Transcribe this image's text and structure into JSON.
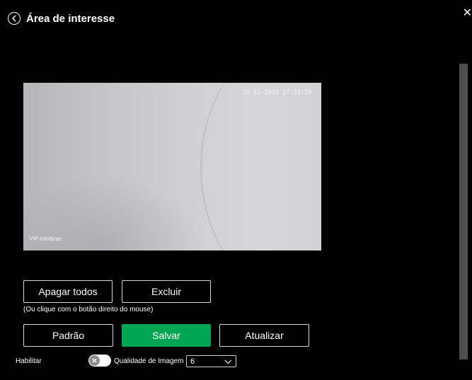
{
  "header": {
    "title": "Área de interesse"
  },
  "video": {
    "timestamp": "26-12-2024 17:33:35",
    "osd_label": "VIP-intelbras"
  },
  "actions": {
    "clear_all": "Apagar todos",
    "delete": "Excluir",
    "hint": "(Ou clique com o botão direito do mouse)",
    "default": "Padrão",
    "save": "Salvar",
    "refresh": "Atualizar"
  },
  "settings": {
    "enable_label": "Habilitar",
    "enable_state": false,
    "quality_label": "Qualidade de Imagem",
    "quality_value": "6"
  },
  "colors": {
    "accent": "#00a651",
    "background": "#000000"
  }
}
